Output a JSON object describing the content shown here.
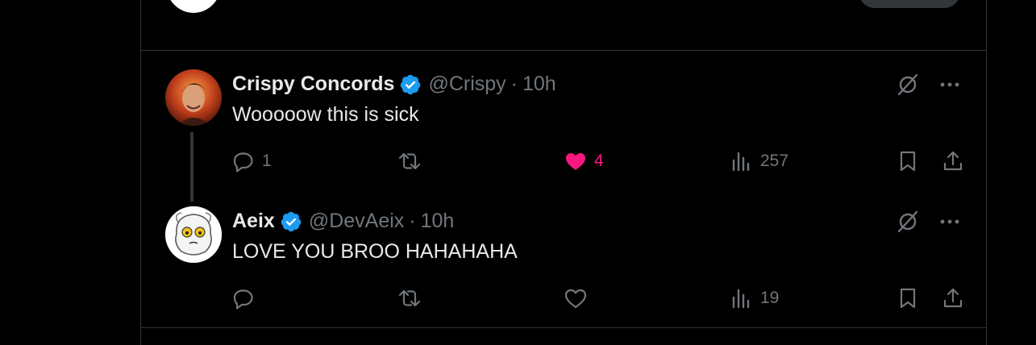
{
  "tweets": [
    {
      "author_name": "Crispy Concords",
      "handle": "@Crispy",
      "separator": "·",
      "time": "10h",
      "text": "Wooooow this is sick",
      "verified": true,
      "liked": true,
      "stats": {
        "replies": "1",
        "reposts": "",
        "likes": "4",
        "views": "257"
      }
    },
    {
      "author_name": "Aeix",
      "handle": "@DevAeix",
      "separator": "·",
      "time": "10h",
      "text": "LOVE YOU BROO HAHAHAHA",
      "verified": true,
      "liked": false,
      "stats": {
        "replies": "",
        "reposts": "",
        "likes": "",
        "views": "19"
      }
    }
  ],
  "colors": {
    "background": "#000000",
    "border": "#2f3336",
    "text_primary": "#e7e9ea",
    "text_secondary": "#71767b",
    "verified_blue": "#1d9bf0",
    "like_pink": "#f91880"
  },
  "icons": [
    "verified-badge-icon",
    "grok-icon",
    "more-icon",
    "reply-icon",
    "repost-icon",
    "like-icon",
    "views-icon",
    "bookmark-icon",
    "share-icon"
  ]
}
